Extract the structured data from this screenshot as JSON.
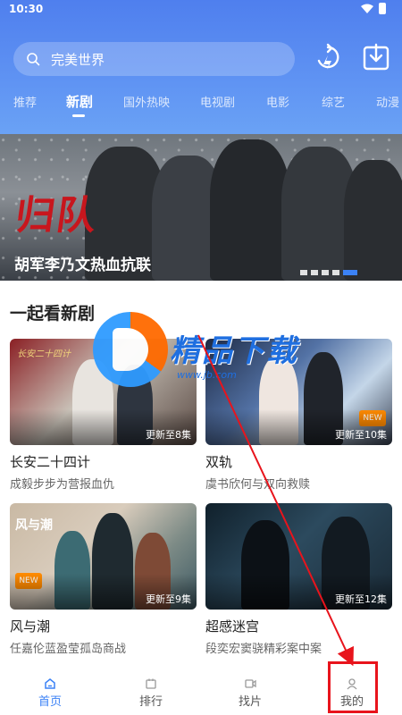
{
  "status": {
    "time": "10:30"
  },
  "search": {
    "placeholder": "完美世界"
  },
  "tabs": [
    {
      "label": "推荐"
    },
    {
      "label": "新剧"
    },
    {
      "label": "国外热映"
    },
    {
      "label": "电视剧"
    },
    {
      "label": "电影"
    },
    {
      "label": "综艺"
    },
    {
      "label": "动漫"
    }
  ],
  "banner": {
    "logo": "归队",
    "title": "胡军李乃文热血抗联"
  },
  "section": {
    "title": "一起看新剧"
  },
  "cards": [
    {
      "title": "长安二十四计",
      "subtitle": "成毅步步为营报血仇",
      "badge": "更新至8集"
    },
    {
      "title": "双轨",
      "subtitle": "虞书欣何与双向救赎",
      "badge": "更新至10集"
    },
    {
      "title": "风与潮",
      "subtitle": "任嘉伦蓝盈莹孤岛商战",
      "badge": "更新至9集"
    },
    {
      "title": "超感迷宫",
      "subtitle": "段奕宏窦骁精彩案中案",
      "badge": "更新至12集"
    }
  ],
  "thumb_labels": {
    "card1": "长安二十四计",
    "card3": "风与潮"
  },
  "watermark": {
    "text": "精品下载",
    "url": "www.jb.com"
  },
  "nav": [
    {
      "label": "首页",
      "icon": "home-icon"
    },
    {
      "label": "排行",
      "icon": "ranking-icon"
    },
    {
      "label": "找片",
      "icon": "film-icon"
    },
    {
      "label": "我的",
      "icon": "user-icon"
    }
  ],
  "colors": {
    "accent": "#3b82f6",
    "header": "#5f93f3",
    "annotation": "#e8141c",
    "watermark": "#1f6fe0"
  }
}
